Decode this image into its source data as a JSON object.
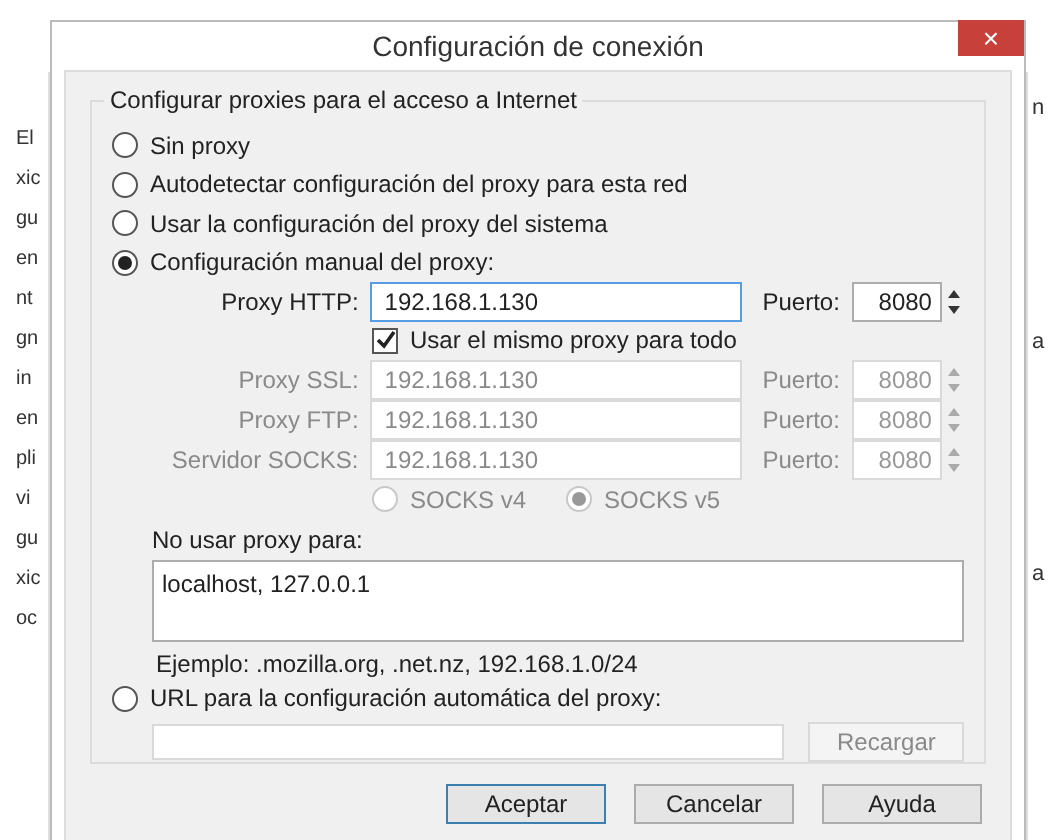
{
  "background_window": {
    "left_fragments": [
      "El",
      "xic",
      "gu",
      "en",
      "nt",
      "gn",
      "in",
      "en",
      "pli",
      "vi",
      "gu",
      "xic",
      "oc"
    ],
    "right_fragments": [
      "n",
      "a",
      "a"
    ]
  },
  "window": {
    "title": "Configuración de conexión",
    "close": "×"
  },
  "group": {
    "legend": "Configurar proxies para el acceso a Internet"
  },
  "modes": [
    {
      "label": "Sin proxy",
      "selected": false
    },
    {
      "label": "Autodetectar configuración del proxy para esta red",
      "selected": false
    },
    {
      "label": "Usar la configuración del proxy del sistema",
      "selected": false
    },
    {
      "label": "Configuración manual del proxy:",
      "selected": true
    }
  ],
  "proxies": [
    {
      "label": "Proxy HTTP:",
      "value": "192.168.1.130",
      "port_label": "Puerto:",
      "port": "8080",
      "disabled": false,
      "focused": true
    },
    {
      "label": "Proxy SSL:",
      "value": "192.168.1.130",
      "port_label": "Puerto:",
      "port": "8080",
      "disabled": true,
      "focused": false
    },
    {
      "label": "Proxy FTP:",
      "value": "192.168.1.130",
      "port_label": "Puerto:",
      "port": "8080",
      "disabled": true,
      "focused": false
    },
    {
      "label": "Servidor SOCKS:",
      "value": "192.168.1.130",
      "port_label": "Puerto:",
      "port": "8080",
      "disabled": true,
      "focused": false
    }
  ],
  "same_proxy": {
    "label": "Usar el mismo proxy para todo",
    "checked": true
  },
  "socks_versions": [
    {
      "label": "SOCKS v4",
      "selected": false
    },
    {
      "label": "SOCKS v5",
      "selected": true
    }
  ],
  "no_proxy": {
    "label": "No usar proxy para:",
    "value": "localhost, 127.0.0.1",
    "example": "Ejemplo: .mozilla.org, .net.nz, 192.168.1.0/24"
  },
  "auto_url": {
    "label": "URL para la configuración automática del proxy:",
    "selected": false,
    "reload": "Recargar"
  },
  "buttons": [
    {
      "label": "Aceptar",
      "default": true
    },
    {
      "label": "Cancelar",
      "default": false
    },
    {
      "label": "Ayuda",
      "default": false
    }
  ]
}
